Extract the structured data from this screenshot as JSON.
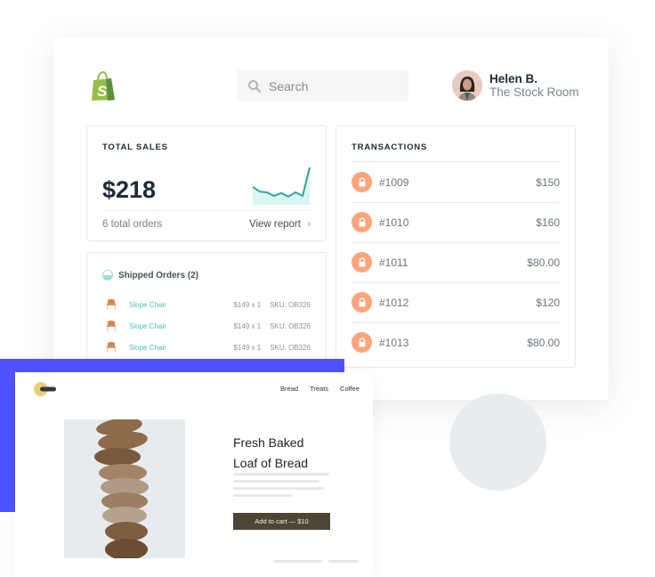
{
  "header": {
    "logo": "shopify-bag-logo",
    "search_placeholder": "Search",
    "user": {
      "name": "Helen B.",
      "store": "The Stock Room"
    }
  },
  "total_sales": {
    "title": "TOTAL SALES",
    "amount": "$218",
    "orders_text": "6 total orders",
    "view_report_label": "View report",
    "chevron": "›",
    "sparkline": [
      0.45,
      0.32,
      0.3,
      0.2,
      0.28,
      0.18,
      0.3,
      0.2,
      1.0
    ],
    "sparkline_color": "#2aa99e"
  },
  "shipped_orders": {
    "title": "Shipped Orders (2)",
    "items": [
      {
        "name": "Slope Chair",
        "price": "$149 x 1",
        "sku": "SKU: OB326"
      },
      {
        "name": "Slope Chair",
        "price": "$149 x 1",
        "sku": "SKU: OB326"
      },
      {
        "name": "Slope Chair",
        "price": "$149 x 1",
        "sku": "SKU: OB326"
      }
    ]
  },
  "transactions": {
    "title": "TRANSACTIONS",
    "items": [
      {
        "id": "#1009",
        "amount": "$150"
      },
      {
        "id": "#1010",
        "amount": "$160"
      },
      {
        "id": "#1011",
        "amount": "$80.00"
      },
      {
        "id": "#1012",
        "amount": "$120"
      },
      {
        "id": "#1013",
        "amount": "$80.00"
      }
    ]
  },
  "storefront": {
    "nav": [
      "Bread",
      "Treats",
      "Coffee"
    ],
    "product_title_line1": "Fresh Baked",
    "product_title_line2": "Loaf of Bread",
    "add_to_cart_label": "Add to cart — $10"
  },
  "colors": {
    "accent_purple": "#5152ff",
    "lock_orange": "#fca47c",
    "link_teal": "#47c1bf",
    "shopify_green": "#95bf47",
    "cart_button": "#4d4535"
  }
}
